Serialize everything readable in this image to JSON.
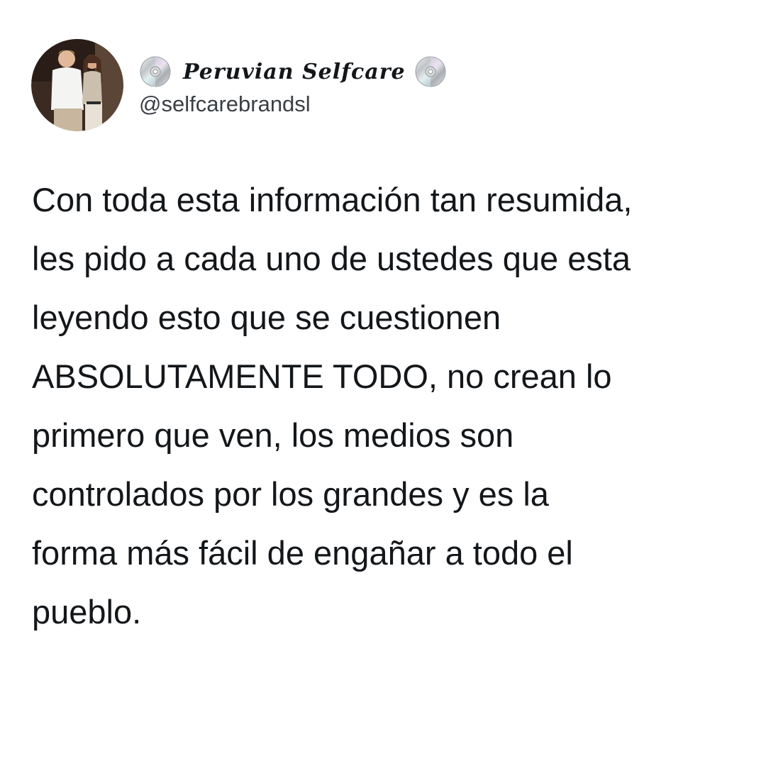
{
  "account": {
    "display_name": "Peruvian Selfcare",
    "handle": "@selfcarebrandsl",
    "name_icon": "cd-disc-icon"
  },
  "tweet": {
    "lines": [
      "Con toda esta información tan resumida,",
      "les pido a cada uno de ustedes que esta",
      "leyendo esto que se cuestionen",
      "ABSOLUTAMENTE TODO, no crean lo",
      "primero que ven, los medios son",
      "controlados por los grandes y es la",
      "forma más fácil de engañar a todo el",
      "pueblo."
    ]
  },
  "colors": {
    "background": "#ffffff",
    "text": "#14171a",
    "handle": "#3a3f44"
  }
}
